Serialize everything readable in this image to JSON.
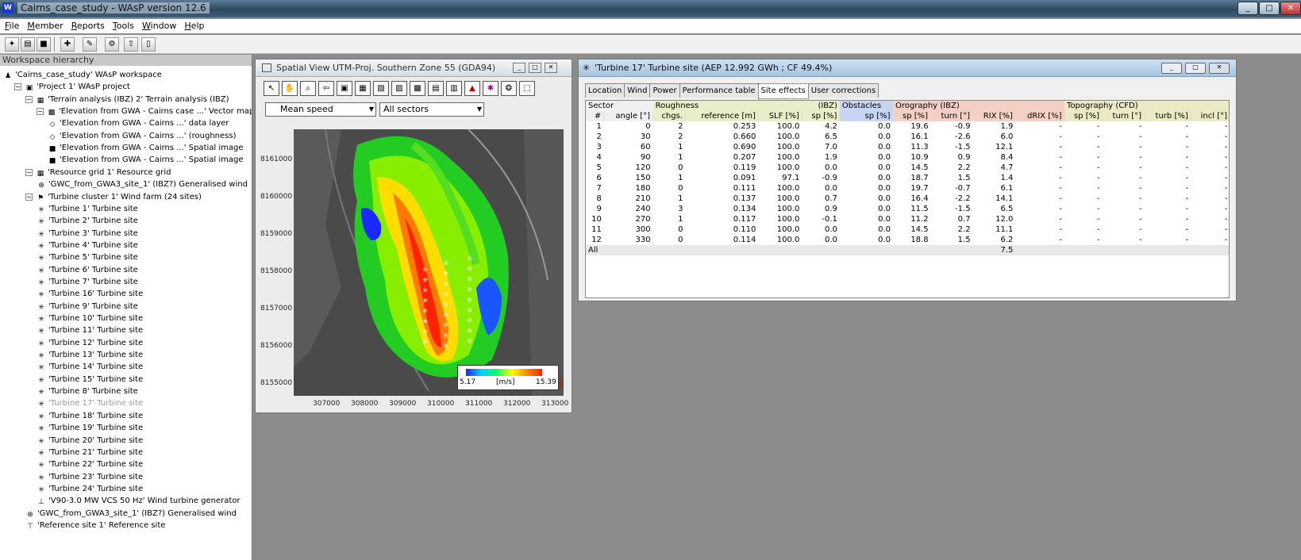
{
  "window": {
    "title": "Cairns_case_study - WAsP version 12.6"
  },
  "menu": [
    {
      "hot": "F",
      "rest": "ile"
    },
    {
      "hot": "M",
      "rest": "ember"
    },
    {
      "hot": "R",
      "rest": "eports"
    },
    {
      "hot": "T",
      "rest": "ools"
    },
    {
      "hot": "W",
      "rest": "indow"
    },
    {
      "hot": "H",
      "rest": "elp"
    }
  ],
  "tree": {
    "header": "Workspace hierarchy",
    "items": [
      "'Cairns_case_study' WAsP workspace",
      "'Project 1' WAsP project",
      "'Terrain analysis (IBZ) 2' Terrain analysis (IBZ)",
      "'Elevation from GWA - Cairns case ...' Vector map",
      "'Elevation from GWA - Cairns ...' data layer",
      "'Elevation from GWA - Cairns ...' (roughness)",
      "'Elevation from GWA - Cairns ...' Spatial image",
      "'Elevation from GWA - Cairns ...' Spatial image",
      "'Resource grid 1' Resource grid",
      "'GWC_from_GWA3_site_1' (IBZ?) Generalised wind",
      "'Turbine cluster 1' Wind farm (24 sites)",
      "'Turbine 1' Turbine site",
      "'Turbine 2' Turbine site",
      "'Turbine 3' Turbine site",
      "'Turbine 4' Turbine site",
      "'Turbine 5' Turbine site",
      "'Turbine 6' Turbine site",
      "'Turbine 7' Turbine site",
      "'Turbine 16' Turbine site",
      "'Turbine 9' Turbine site",
      "'Turbine 10' Turbine site",
      "'Turbine 11' Turbine site",
      "'Turbine 12' Turbine site",
      "'Turbine 13' Turbine site",
      "'Turbine 14' Turbine site",
      "'Turbine 15' Turbine site",
      "'Turbine 8' Turbine site",
      "'Turbine 17' Turbine site",
      "'Turbine 18' Turbine site",
      "'Turbine 19' Turbine site",
      "'Turbine 20' Turbine site",
      "'Turbine 21' Turbine site",
      "'Turbine 22' Turbine site",
      "'Turbine 23' Turbine site",
      "'Turbine 24' Turbine site",
      "'V90-3.0 MW VCS 50 Hz' Wind turbine generator",
      "'GWC_from_GWA3_site_1' (IBZ?) Generalised wind",
      "'Reference site 1' Reference site"
    ]
  },
  "spatial": {
    "title": "Spatial View UTM-Proj. Southern Zone 55 (GDA94)",
    "variable": "Mean speed",
    "sectors": "All sectors",
    "y_ticks": [
      "8161000",
      "8160000",
      "8159000",
      "8158000",
      "8157000",
      "8156000",
      "8155000"
    ],
    "x_ticks": [
      "307000",
      "308000",
      "309000",
      "310000",
      "311000",
      "312000",
      "313000"
    ],
    "legend_min": "5.17",
    "legend_unit": "[m/s]",
    "legend_max": "15.39"
  },
  "site": {
    "title": "'Turbine 17' Turbine site (AEP 12.992 GWh ; CF 49.4%)",
    "tabs": [
      "Location",
      "Wind",
      "Power",
      "Performance table",
      "Site effects",
      "User corrections"
    ],
    "active_tab": "Site effects",
    "group_headers": {
      "sector": "Sector",
      "roughness": "Roughness",
      "ibz": "(IBZ)",
      "obstacles": "Obstacles",
      "orography": "Orography (IBZ)",
      "topography": "Topography (CFD)"
    },
    "col_headers": [
      "#",
      "angle [°]",
      "chgs.",
      "reference [m]",
      "SLF [%]",
      "sp [%]",
      "sp [%]",
      "sp [%]",
      "turn [°]",
      "RIX [%]",
      "dRIX [%]",
      "sp [%]",
      "turn [°]",
      "turb [%]",
      "incl [°]"
    ],
    "rows": [
      [
        "1",
        "0",
        "2",
        "0.253",
        "100.0",
        "4.2",
        "0.0",
        "19.6",
        "-0.9",
        "1.9",
        "-",
        "-",
        "-",
        "-",
        "-"
      ],
      [
        "2",
        "30",
        "2",
        "0.660",
        "100.0",
        "6.5",
        "0.0",
        "16.1",
        "-2.6",
        "6.0",
        "-",
        "-",
        "-",
        "-",
        "-"
      ],
      [
        "3",
        "60",
        "1",
        "0.690",
        "100.0",
        "7.0",
        "0.0",
        "11.3",
        "-1.5",
        "12.1",
        "-",
        "-",
        "-",
        "-",
        "-"
      ],
      [
        "4",
        "90",
        "1",
        "0.207",
        "100.0",
        "1.9",
        "0.0",
        "10.9",
        "0.9",
        "8.4",
        "-",
        "-",
        "-",
        "-",
        "-"
      ],
      [
        "5",
        "120",
        "0",
        "0.119",
        "100.0",
        "0.0",
        "0.0",
        "14.5",
        "2.2",
        "4.7",
        "-",
        "-",
        "-",
        "-",
        "-"
      ],
      [
        "6",
        "150",
        "1",
        "0.091",
        "97.1",
        "-0.9",
        "0.0",
        "18.7",
        "1.5",
        "1.4",
        "-",
        "-",
        "-",
        "-",
        "-"
      ],
      [
        "7",
        "180",
        "0",
        "0.111",
        "100.0",
        "0.0",
        "0.0",
        "19.7",
        "-0.7",
        "6.1",
        "-",
        "-",
        "-",
        "-",
        "-"
      ],
      [
        "8",
        "210",
        "1",
        "0.137",
        "100.0",
        "0.7",
        "0.0",
        "16.4",
        "-2.2",
        "14.1",
        "-",
        "-",
        "-",
        "-",
        "-"
      ],
      [
        "9",
        "240",
        "3",
        "0.134",
        "100.0",
        "0.9",
        "0.0",
        "11.5",
        "-1.5",
        "6.5",
        "-",
        "-",
        "-",
        "-",
        "-"
      ],
      [
        "10",
        "270",
        "1",
        "0.117",
        "100.0",
        "-0.1",
        "0.0",
        "11.2",
        "0.7",
        "12.0",
        "-",
        "-",
        "-",
        "-",
        "-"
      ],
      [
        "11",
        "300",
        "0",
        "0.110",
        "100.0",
        "0.0",
        "0.0",
        "14.5",
        "2.2",
        "11.1",
        "-",
        "-",
        "-",
        "-",
        "-"
      ],
      [
        "12",
        "330",
        "0",
        "0.114",
        "100.0",
        "0.0",
        "0.0",
        "18.8",
        "1.5",
        "6.2",
        "-",
        "-",
        "-",
        "-",
        "-"
      ]
    ],
    "all_label": "All",
    "all_value": "7.5"
  }
}
